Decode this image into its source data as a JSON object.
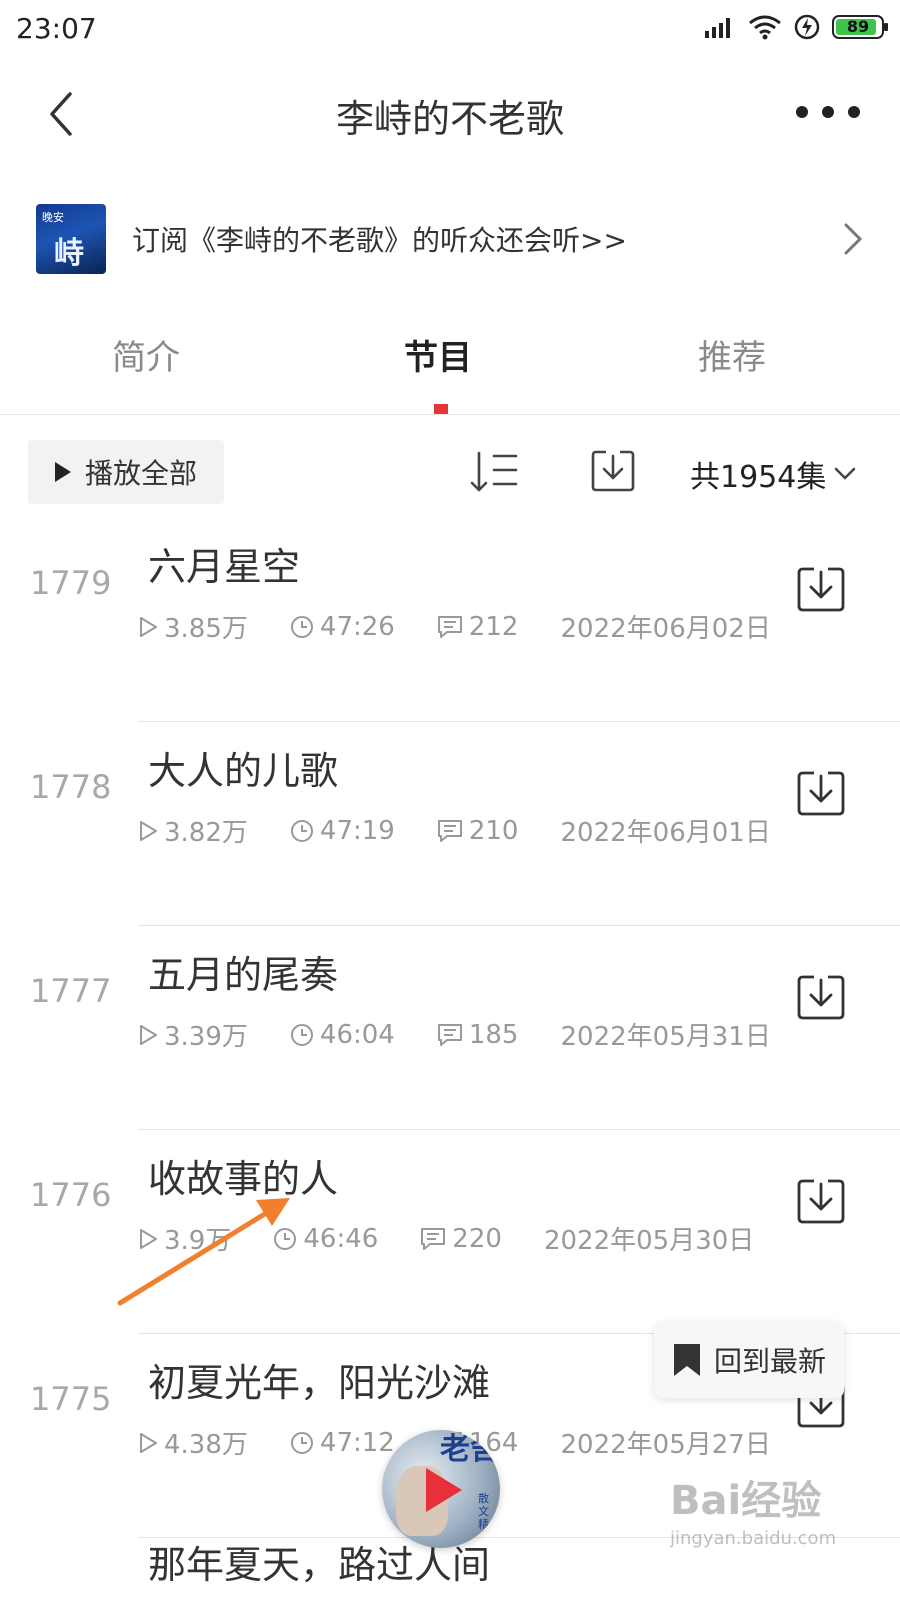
{
  "status_bar": {
    "time": "23:07",
    "battery": "89"
  },
  "header": {
    "title": "李峙的不老歌"
  },
  "promo": {
    "text": "订阅《李峙的不老歌》的听众还会听>>",
    "cover_line1": "晚安",
    "cover_line2": "峙"
  },
  "tabs": [
    {
      "label": "简介",
      "active": false
    },
    {
      "label": "节目",
      "active": true
    },
    {
      "label": "推荐",
      "active": false
    }
  ],
  "toolbar": {
    "play_all": "播放全部",
    "episode_count": "共1954集"
  },
  "episodes": [
    {
      "number": "1779",
      "title": "六月星空",
      "plays": "3.85万",
      "duration": "47:26",
      "comments": "212",
      "date": "2022年06月02日"
    },
    {
      "number": "1778",
      "title": "大人的儿歌",
      "plays": "3.82万",
      "duration": "47:19",
      "comments": "210",
      "date": "2022年06月01日"
    },
    {
      "number": "1777",
      "title": "五月的尾奏",
      "plays": "3.39万",
      "duration": "46:04",
      "comments": "185",
      "date": "2022年05月31日"
    },
    {
      "number": "1776",
      "title": "收故事的人",
      "plays": "3.9万",
      "duration": "46:46",
      "comments": "220",
      "date": "2022年05月30日"
    },
    {
      "number": "1775",
      "title": "初夏光年，阳光沙滩",
      "plays": "4.38万",
      "duration": "47:12",
      "comments": "164",
      "date": "2022年05月27日"
    },
    {
      "number": "",
      "title": "那年夏天，路过人间",
      "plays": "",
      "duration": "",
      "comments": "",
      "date": ""
    }
  ],
  "floating": {
    "back_to_latest": "回到最新",
    "player_badge": "老舍",
    "player_badge_small": "散文精"
  },
  "watermark": {
    "logo": "Bai经验",
    "url": "jingyan.baidu.com"
  },
  "colors": {
    "accent": "#e63535",
    "annotation_arrow": "#f07f2e"
  }
}
